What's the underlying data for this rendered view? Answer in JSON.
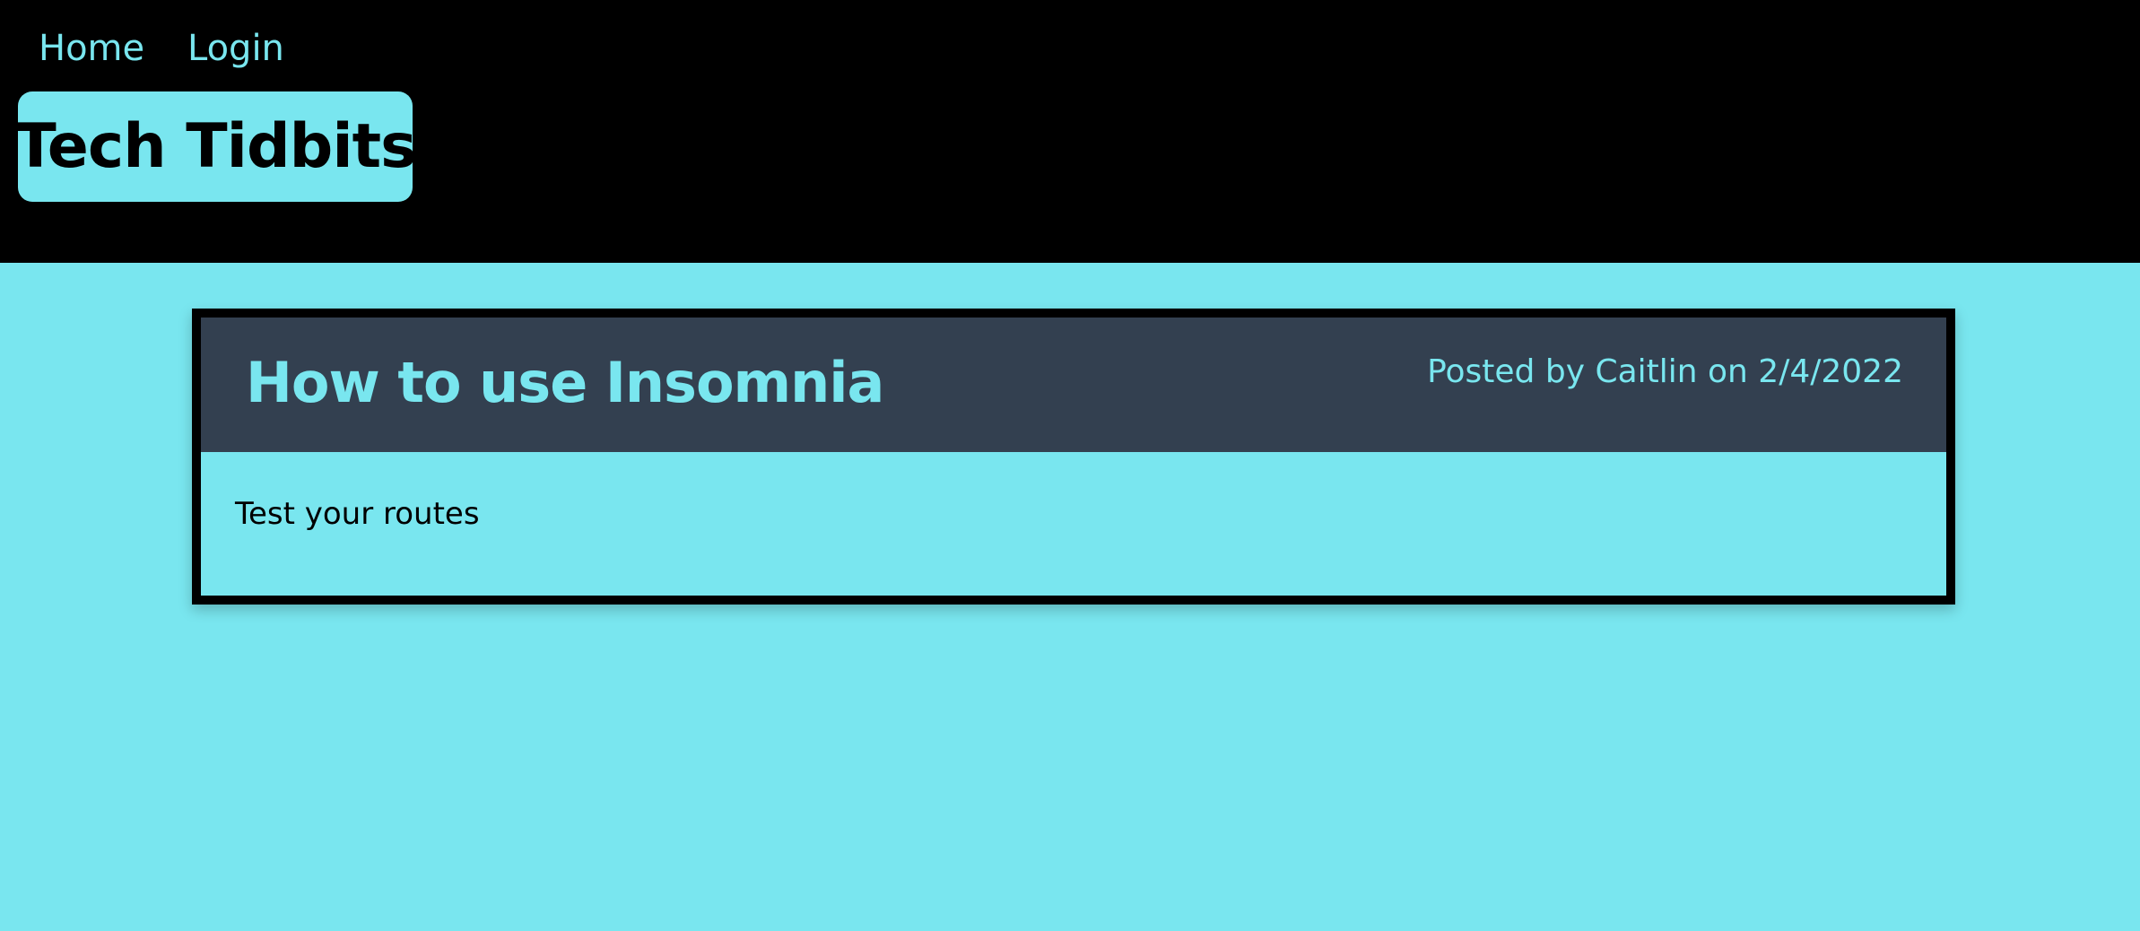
{
  "nav": {
    "home_label": "Home",
    "login_label": "Login"
  },
  "site": {
    "title": "Tech Tidbits"
  },
  "post": {
    "title": "How to use Insomnia",
    "meta": "Posted by Caitlin on 2/4/2022",
    "body": "Test your routes"
  },
  "colors": {
    "header_bg": "#000000",
    "accent": "#79e6ef",
    "post_header_bg": "#334050",
    "page_bg": "#79e6ef"
  }
}
